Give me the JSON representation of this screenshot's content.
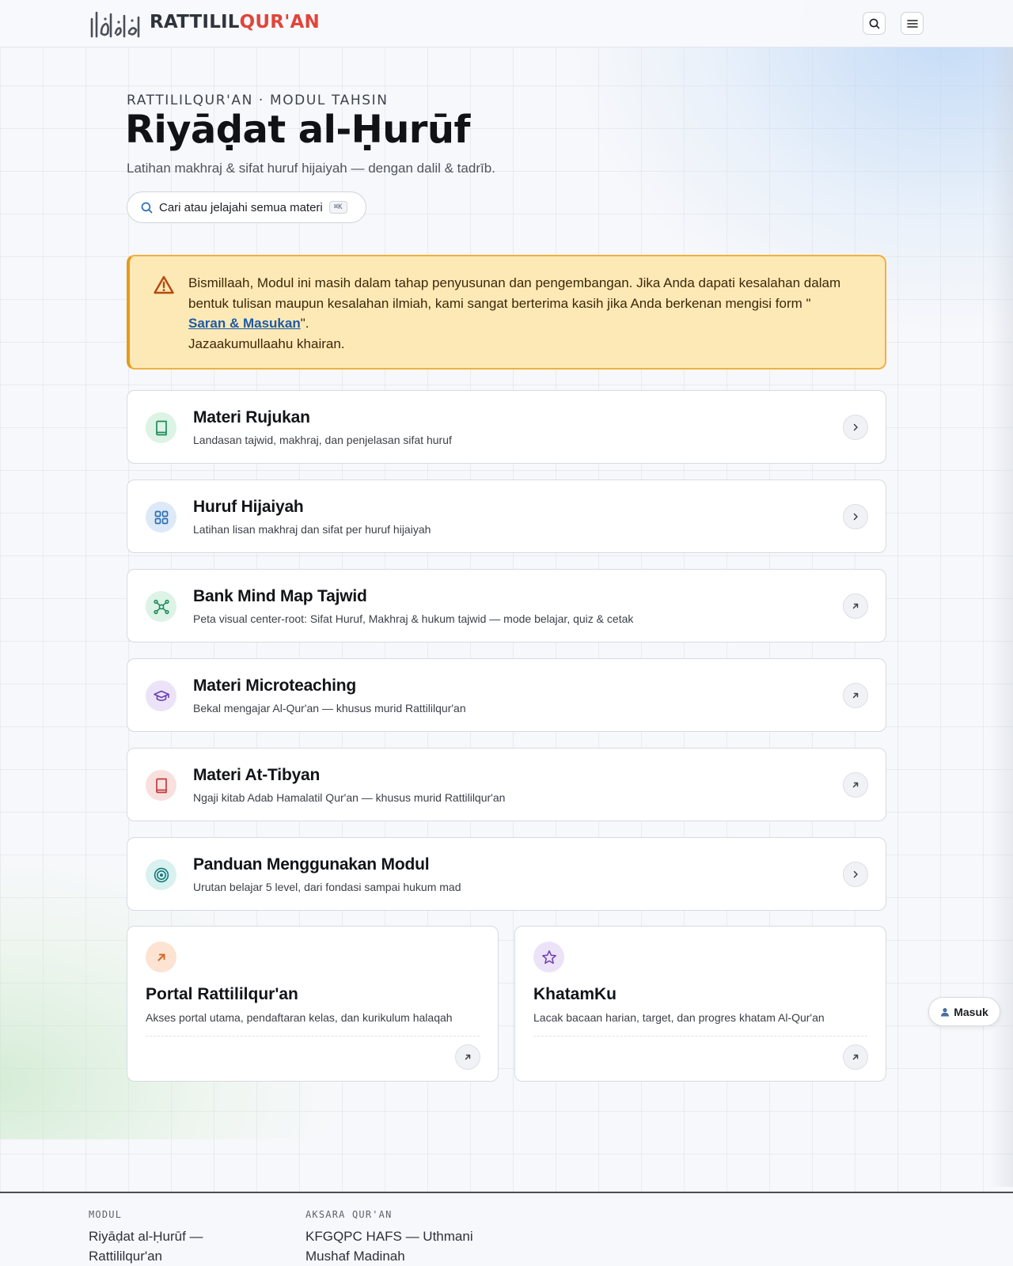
{
  "header": {
    "logo_text_main": "RATTILIL",
    "logo_text_accent": "QUR'AN",
    "logo_calligraphy": "رتل القرآن",
    "search_icon": "search-icon",
    "menu_icon": "menu-icon"
  },
  "hero": {
    "eyebrow": "RATTILILQUR'AN · MODUL TAHSIN",
    "title": "Riyāḍat al-Ḥurūf",
    "subtitle": "Latihan makhraj & sifat huruf hijaiyah — dengan dalil & tadrīb.",
    "search_label": "Cari atau jelajahi semua materi",
    "search_shortcut": "⌘K"
  },
  "alert": {
    "icon": "warning-icon",
    "text_before": "Bismillaah, Modul ini masih dalam tahap penyusunan dan pengembangan. Jika Anda dapati kesalahan dalam bentuk tulisan maupun kesalahan ilmiah, kami sangat berterima kasih jika Anda berkenan mengisi form \"",
    "link_text": "Saran & Masukan",
    "text_after": "\".",
    "closing": "Jazaakumullaahu khairan."
  },
  "cards": [
    {
      "title": "Materi Rujukan",
      "desc": "Landasan tajwid, makhraj, dan penjelasan sifat huruf",
      "icon": "book-icon",
      "action": "chevron-right-icon",
      "color": "#1f8a5a",
      "bg": "#dcf3e6"
    },
    {
      "title": "Huruf Hijaiyah",
      "desc": "Latihan lisan makhraj dan sifat per huruf hijaiyah",
      "icon": "grid-icon",
      "action": "chevron-right-icon",
      "color": "#2c6fb5",
      "bg": "#dde9f7"
    },
    {
      "title": "Bank Mind Map Tajwid",
      "desc": "Peta visual center-root: Sifat Huruf, Makhraj & hukum tajwid — mode belajar, quiz & cetak",
      "icon": "mind-map-icon",
      "action": "arrow-up-right-icon",
      "color": "#1f8a5a",
      "bg": "#dcf3e6"
    },
    {
      "title": "Materi Microteaching",
      "desc": "Bekal mengajar Al-Qur'an — khusus murid Rattililqur'an",
      "icon": "graduation-cap-icon",
      "action": "arrow-up-right-icon",
      "color": "#6b3fb0",
      "bg": "#ece3f8"
    },
    {
      "title": "Materi At-Tibyan",
      "desc": "Ngaji kitab Adab Hamalatil Qur'an — khusus murid Rattililqur'an",
      "icon": "book-icon",
      "action": "arrow-up-right-icon",
      "color": "#c23b3b",
      "bg": "#f8e0df"
    },
    {
      "title": "Panduan Menggunakan Modul",
      "desc": "Urutan belajar 5 level, dari fondasi sampai hukum mad",
      "icon": "target-icon",
      "action": "chevron-right-icon",
      "color": "#147a7a",
      "bg": "#d9f1ef"
    }
  ],
  "tiles": [
    {
      "title": "Portal Rattililqur'an",
      "desc": "Akses portal utama, pendaftaran kelas, dan kurikulum halaqah",
      "icon": "arrow-up-right-icon",
      "color": "#d2692a",
      "bg": "#fce3d2"
    },
    {
      "title": "KhatamKu",
      "desc": "Lacak bacaan harian, target, dan progres khatam Al-Qur'an",
      "icon": "star-icon",
      "color": "#6b3fb0",
      "bg": "#ece3f8"
    }
  ],
  "login": {
    "icon": "user-icon",
    "label": "Masuk"
  },
  "footer": {
    "col1_heading": "MODUL",
    "col1_value": "Riyāḍat al-Ḥurūf — Rattililqur'an",
    "col2_heading": "AKSARA QUR'AN",
    "col2_value": "KFGQPC HAFS — Uthmani Mushaf Madinah"
  }
}
